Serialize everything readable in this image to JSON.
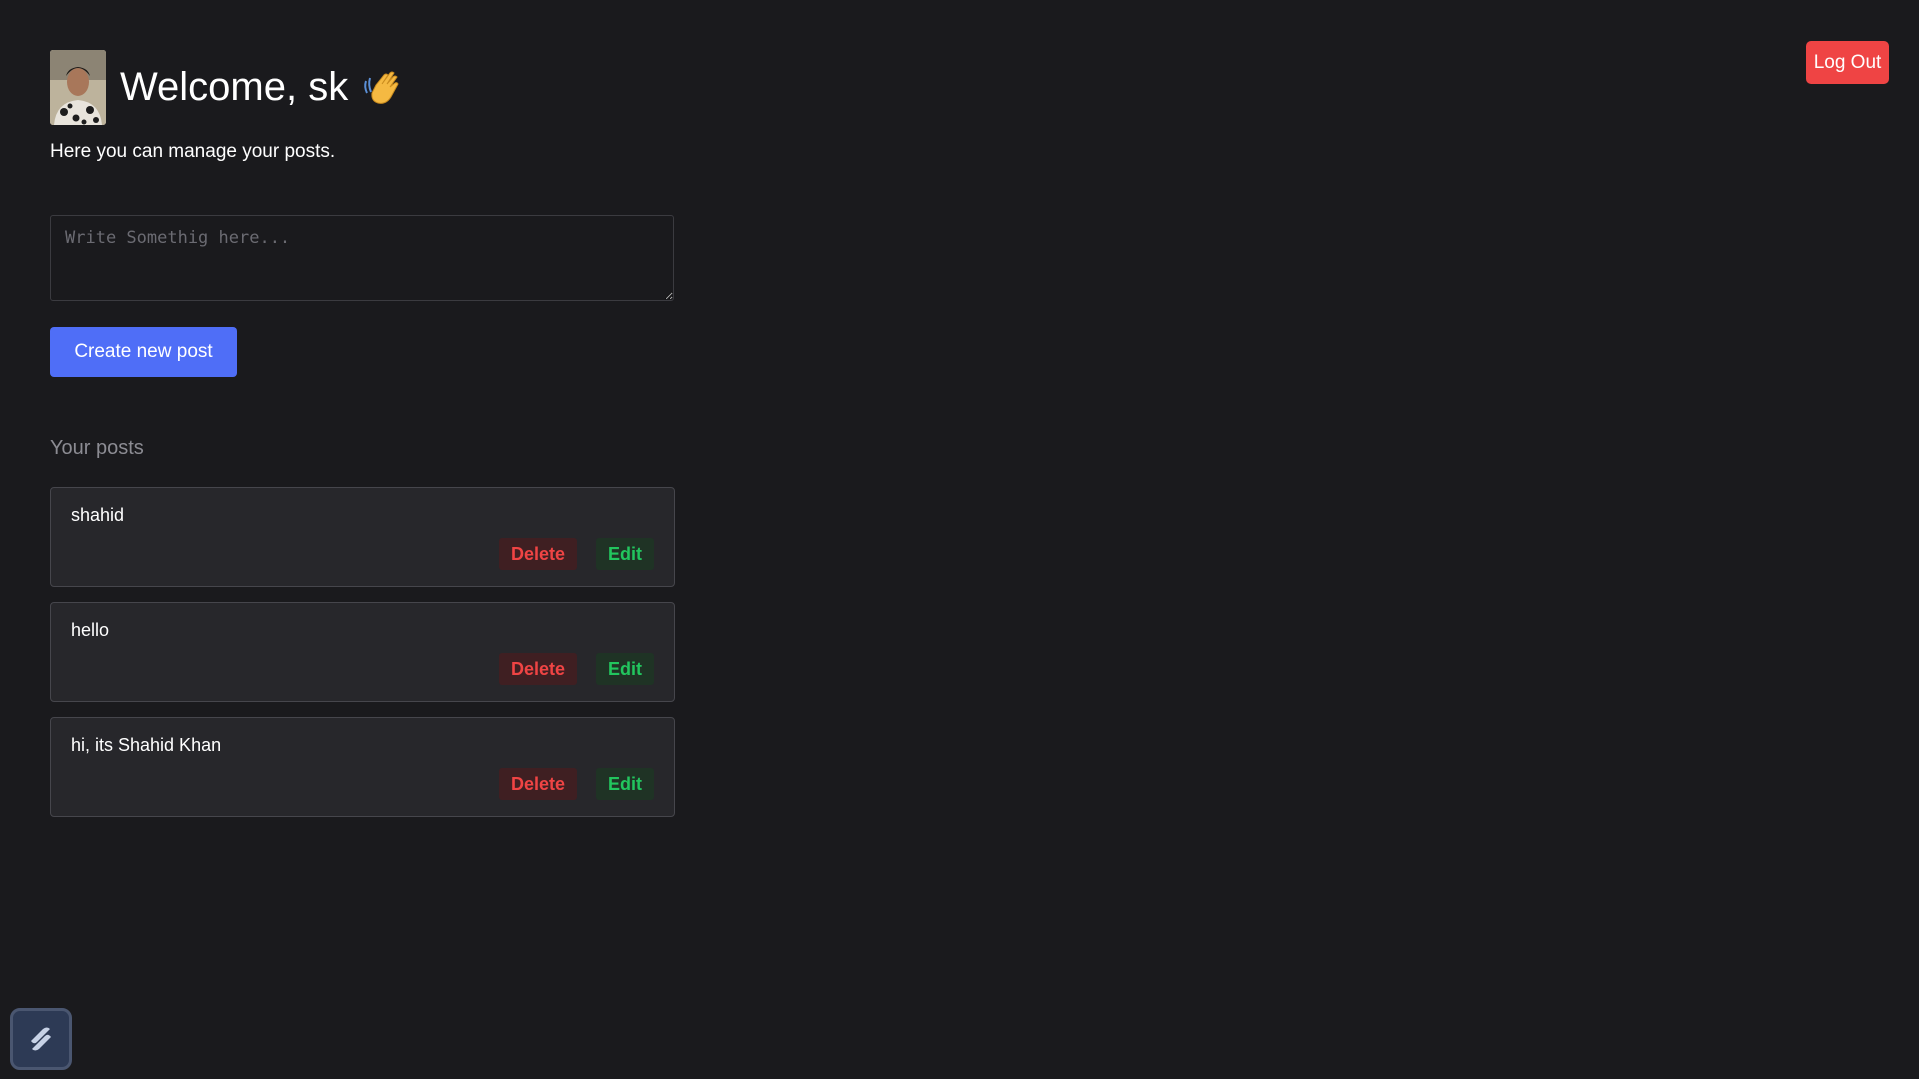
{
  "header": {
    "title": "Welcome, sk",
    "subtitle": "Here you can manage your posts.",
    "wave_emoji": "wave-hand-icon",
    "avatar": "user-avatar-photo"
  },
  "toolbar": {
    "logout_label": "Log Out"
  },
  "composer": {
    "placeholder": "Write Somethig here...",
    "value": "",
    "create_label": "Create new post"
  },
  "posts_section": {
    "title": "Your posts",
    "items": [
      {
        "text": "shahid",
        "delete_label": "Delete",
        "edit_label": "Edit"
      },
      {
        "text": "hello",
        "delete_label": "Delete",
        "edit_label": "Edit"
      },
      {
        "text": "hi, its Shahid Khan",
        "delete_label": "Delete",
        "edit_label": "Edit"
      }
    ]
  },
  "colors": {
    "background": "#1a1a1d",
    "primary": "#4f6ef7",
    "danger": "#ef4444",
    "success": "#22c55e",
    "card": "#27272b"
  },
  "badge": {
    "icon": "app-logo-icon"
  }
}
